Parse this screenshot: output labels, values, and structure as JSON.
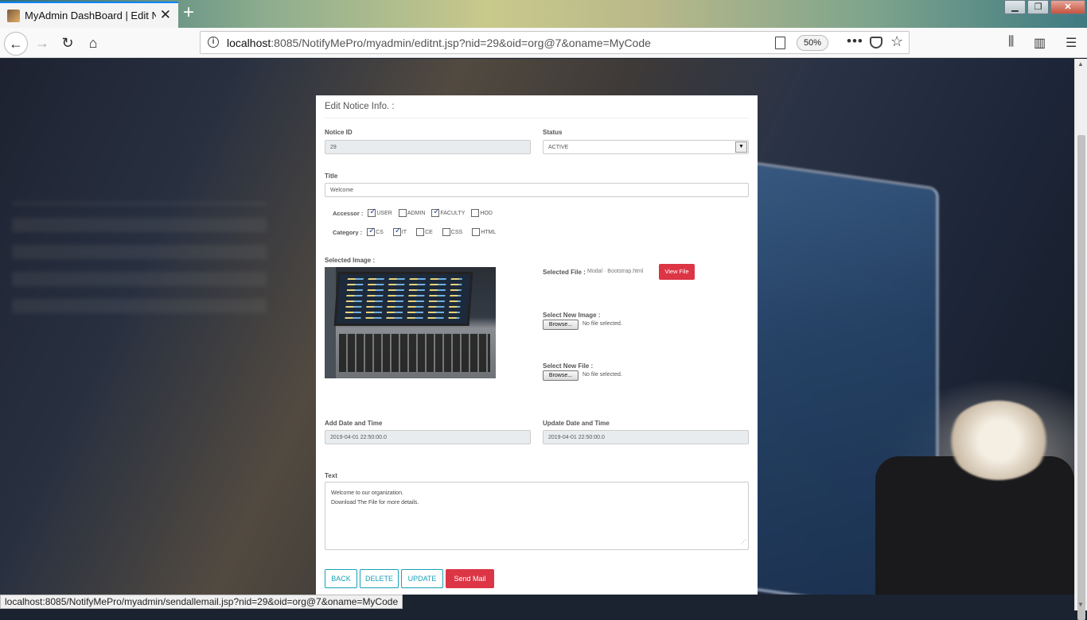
{
  "browser": {
    "tab_title": "MyAdmin DashBoard | Edit Notice",
    "url_host": "localhost",
    "url_rest": ":8085/NotifyMePro/myadmin/editnt.jsp?nid=29&oid=org@7&oname=MyCode",
    "zoom": "50%",
    "status_url": "localhost:8085/NotifyMePro/myadmin/sendallemail.jsp?nid=29&oid=org@7&oname=MyCode"
  },
  "card": {
    "title": "Edit Notice Info. :",
    "notice_id_label": "Notice ID",
    "notice_id": "29",
    "status_label": "Status",
    "status": "ACTIVE",
    "title_label": "Title",
    "title_value": "Welcome",
    "accessor_label": "Accessor :",
    "accessors": [
      {
        "label": "USER",
        "checked": true
      },
      {
        "label": "ADMIN",
        "checked": false
      },
      {
        "label": "FACULTY",
        "checked": true
      },
      {
        "label": "HOD",
        "checked": false
      }
    ],
    "category_label": "Category :",
    "categories": [
      {
        "label": "CS",
        "checked": true
      },
      {
        "label": "IT",
        "checked": true
      },
      {
        "label": "CE",
        "checked": false
      },
      {
        "label": "CSS",
        "checked": false
      },
      {
        "label": "HTML",
        "checked": false
      }
    ],
    "selected_image_label": "Selected Image :",
    "selected_file_label": "Selected File :",
    "selected_file_name": "Modal · Bootstrap.html",
    "view_file": "View File",
    "new_image_label": "Select New Image :",
    "new_file_label": "Select New File :",
    "browse": "Browse...",
    "no_file": "No file selected.",
    "add_dt_label": "Add Date and Time",
    "add_dt": "2019-04-01 22:50:00.0",
    "update_dt_label": "Update Date and Time",
    "update_dt": "2019-04-01 22:50:00.0",
    "text_label": "Text",
    "text_value": " Welcome to our organization.\nDownload The File for more details.",
    "buttons": {
      "back": "BACK",
      "delete": "DELETE",
      "update": "UPDATE",
      "send_mail": "Send Mail"
    }
  },
  "colors": {
    "accent": "#17a2b8",
    "danger": "#dc3545",
    "tab_highlight": "#0a84ff"
  }
}
